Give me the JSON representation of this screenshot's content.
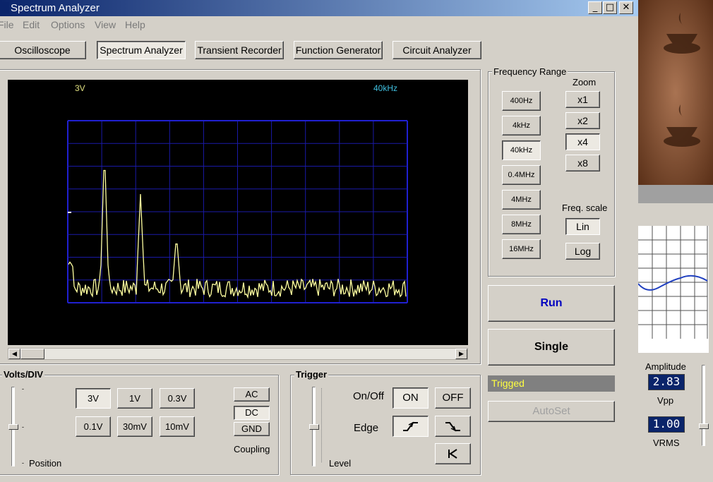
{
  "window": {
    "title": "Spectrum Analyzer",
    "min": "_",
    "max": "□",
    "close": "✕"
  },
  "menu": [
    "File",
    "Edit",
    "Options",
    "View",
    "Help"
  ],
  "modes": [
    "Oscilloscope",
    "Spectrum Analyzer",
    "Transient Recorder",
    "Function Generator",
    "Circuit Analyzer"
  ],
  "active_mode": "Spectrum Analyzer",
  "screen": {
    "volts_label": "3V",
    "freq_label": "40kHz",
    "trace_color": "#ffffa0",
    "grid_color": "#1a1aa8",
    "grid_border_color": "#2020d0",
    "label_left_color": "#e0e080",
    "label_right_color": "#40c0e0"
  },
  "frequency_range": {
    "title": "Frequency Range",
    "buttons": [
      "400Hz",
      "4kHz",
      "40kHz",
      "0.4MHz",
      "4MHz",
      "8MHz",
      "16MHz"
    ],
    "selected": "40kHz",
    "zoom_title": "Zoom",
    "zoom": [
      "x1",
      "x2",
      "x4",
      "x8"
    ],
    "zoom_selected": "x4",
    "scale_title": "Freq. scale",
    "scale": [
      "Lin",
      "Log"
    ],
    "scale_selected": "Lin"
  },
  "run_label": "Run",
  "single_label": "Single",
  "status": {
    "text": "Trigged",
    "color": "#ffff40",
    "bg": "#808080"
  },
  "autoset_label": "AutoSet",
  "volts_div": {
    "title": "Volts/DIV",
    "buttons": [
      "3V",
      "1V",
      "0.3V",
      "0.1V",
      "30mV",
      "10mV"
    ],
    "selected": "3V",
    "position_label": "Position",
    "coupling": [
      "AC",
      "DC",
      "GND"
    ],
    "coupling_selected": "DC",
    "coupling_label": "Coupling"
  },
  "trigger": {
    "title": "Trigger",
    "onoff_label": "On/Off",
    "on": "ON",
    "off": "OFF",
    "on_selected": true,
    "edge_label": "Edge",
    "level_label": "Level"
  },
  "side": {
    "amplitude_label": "Amplitude",
    "amplitude_value": "2.83",
    "vpp_label": "Vpp",
    "vrms_value": "1.00",
    "vrms_label": "VRMS",
    "lcd_bg": "#0a246a",
    "wave_color": "#2040c0"
  }
}
